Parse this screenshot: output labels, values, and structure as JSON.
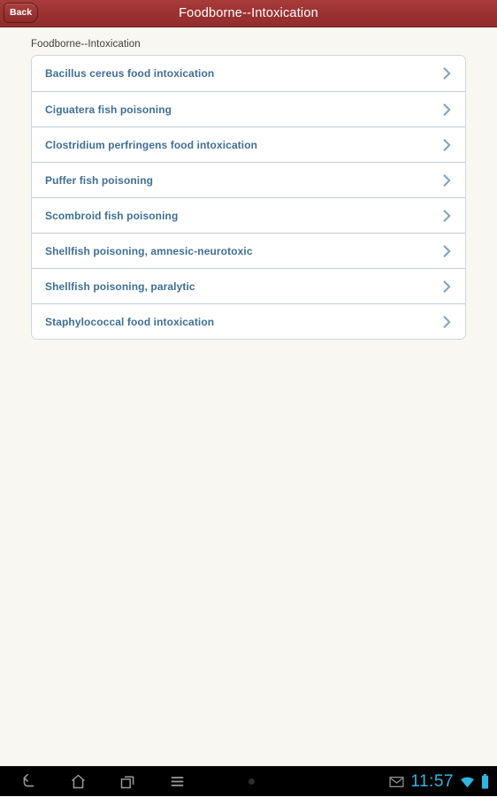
{
  "titlebar": {
    "title": "Foodborne--Intoxication",
    "back_label": "Back",
    "bar_color": "#9c3232",
    "title_color": "#ffffff"
  },
  "content": {
    "section_label": "Foodborne--Intoxication",
    "background_color": "#f8f7f2",
    "item_text_color": "#3f6f96",
    "chevron_icon": "chevron-right-icon",
    "items": [
      {
        "label": "Bacillus cereus food intoxication"
      },
      {
        "label": "Ciguatera fish poisoning"
      },
      {
        "label": "Clostridium perfringens food intoxication"
      },
      {
        "label": "Puffer fish poisoning"
      },
      {
        "label": "Scombroid fish poisoning"
      },
      {
        "label": "Shellfish poisoning, amnesic-neurotoxic"
      },
      {
        "label": "Shellfish poisoning, paralytic"
      },
      {
        "label": "Staphylococcal food intoxication"
      }
    ]
  },
  "navbar": {
    "buttons": [
      {
        "icon": "back-arrow-icon"
      },
      {
        "icon": "home-icon"
      },
      {
        "icon": "recent-apps-icon"
      },
      {
        "icon": "menu-icon"
      }
    ],
    "notification_dot": "notification-dot-icon",
    "status": {
      "mail_icon": "gmail-icon",
      "clock": "11:57",
      "wifi_icon": "wifi-icon",
      "battery_icon": "battery-full-icon",
      "accent_color": "#2fb4e0"
    }
  }
}
